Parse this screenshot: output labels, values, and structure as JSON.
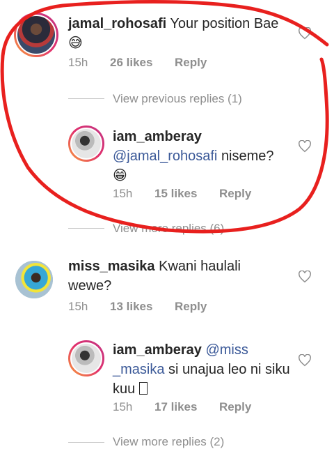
{
  "comments": [
    {
      "username": "jamal_rohosafi",
      "text": "Your position Bae",
      "emoji": "😅",
      "time": "15h",
      "likes": "26 likes",
      "reply": "Reply"
    },
    {
      "username": "iam_amberay",
      "mention": "@jamal_rohosafi",
      "text": "niseme?",
      "emoji": "😁",
      "time": "15h",
      "likes": "15 likes",
      "reply": "Reply"
    },
    {
      "username": "miss_masika",
      "text": "Kwani haulali wewe?",
      "time": "15h",
      "likes": "13 likes",
      "reply": "Reply"
    },
    {
      "username": "iam_amberay",
      "mention": "@miss _masika",
      "text": "si unajua leo ni siku kuu",
      "time": "15h",
      "likes": "17 likes",
      "reply": "Reply"
    }
  ],
  "view_previous": "View previous replies (1)",
  "view_more_1": "View more replies (6)",
  "view_more_2": "View more replies (2)"
}
